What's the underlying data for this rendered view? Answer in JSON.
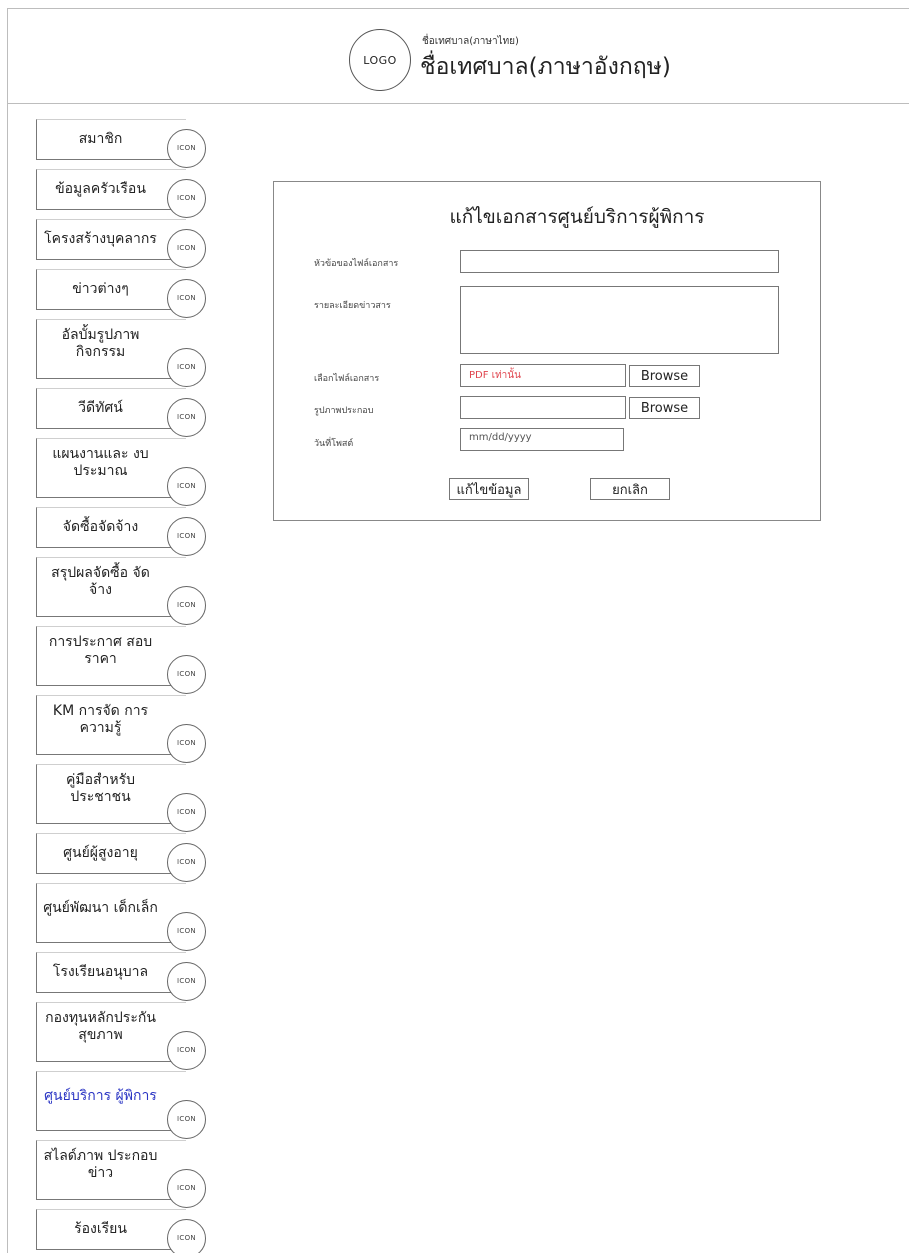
{
  "header": {
    "logo_text": "LOGO",
    "subtitle": "ชื่อเทศบาล(ภาษาไทย)",
    "title": "ชื่อเทศบาล(ภาษาอังกฤษ)"
  },
  "sidebar": {
    "icon_text": "ICON",
    "active_index": 16,
    "items": [
      {
        "label": "สมาชิก"
      },
      {
        "label": "ข้อมูลครัวเรือน"
      },
      {
        "label": "โครงสร้างบุคลากร"
      },
      {
        "label": "ข่าวต่างๆ"
      },
      {
        "label": "อัลบั้มรูปภาพ กิจกรรม"
      },
      {
        "label": "วีดีทัศน์"
      },
      {
        "label": "แผนงานและ งบประมาณ"
      },
      {
        "label": "จัดซื้อจัดจ้าง"
      },
      {
        "label": "สรุปผลจัดซื้อ จัดจ้าง"
      },
      {
        "label": "การประกาศ สอบราคา"
      },
      {
        "label": "KM การจัด การความรู้"
      },
      {
        "label": "คู่มือสำหรับ ประชาชน"
      },
      {
        "label": "ศูนย์ผู้สูงอายุ"
      },
      {
        "label": "ศูนย์พัฒนา เด็กเล็ก"
      },
      {
        "label": "โรงเรียนอนุบาล"
      },
      {
        "label": "กองทุนหลักประกัน สุขภาพ"
      },
      {
        "label": "ศูนย์บริการ ผู้พิการ"
      },
      {
        "label": "สไลด์ภาพ ประกอบข่าว"
      },
      {
        "label": "ร้องเรียน"
      }
    ]
  },
  "form": {
    "title": "แก้ไขเอกสารศูนย์บริการผู้พิการ",
    "fields": {
      "doc_title_label": "หัวข้อของไฟล์เอกสาร",
      "doc_title_value": "",
      "detail_label": "รายละเอียดข่าวสาร",
      "detail_value": "",
      "file_label": "เลือกไฟล์เอกสาร",
      "file_placeholder": "PDF เท่านั้น",
      "image_label": "รูปภาพประกอบ",
      "image_value": "",
      "date_label": "วันที่โพสต์",
      "date_placeholder": "mm/dd/yyyy"
    },
    "browse_label": "Browse",
    "submit_label": "แก้ไขข้อมูล",
    "cancel_label": "ยกเลิก"
  }
}
